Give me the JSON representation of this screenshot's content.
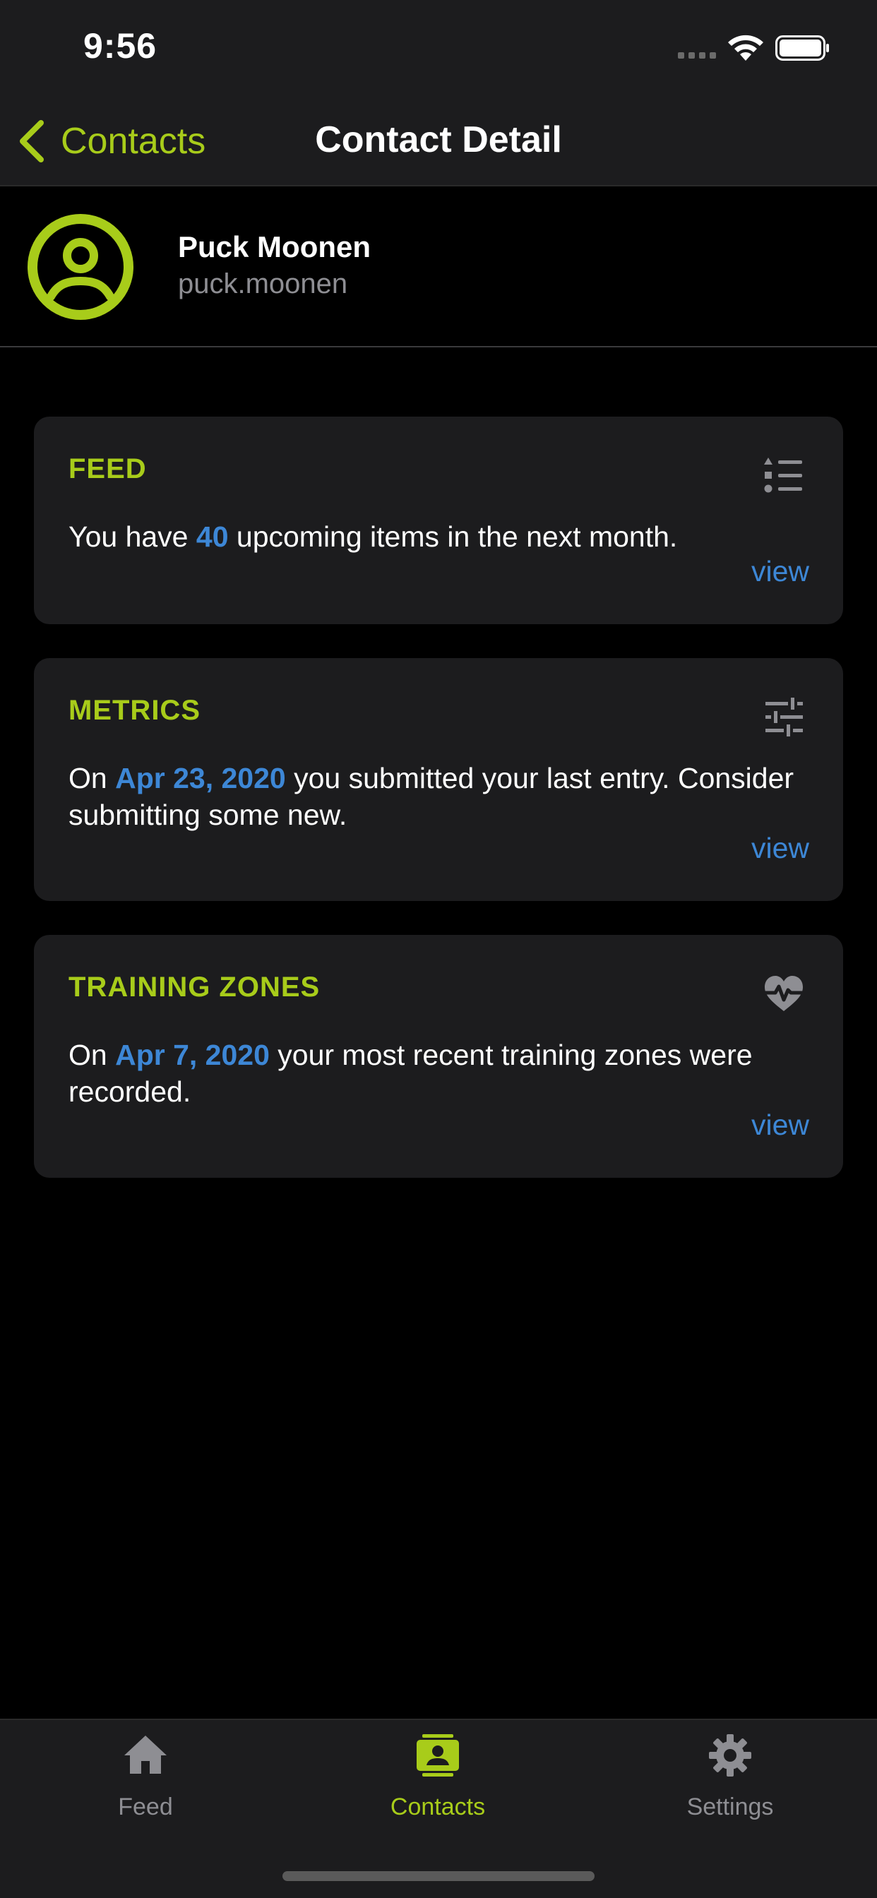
{
  "status_bar": {
    "time": "9:56"
  },
  "nav": {
    "back_label": "Contacts",
    "title": "Contact Detail"
  },
  "profile": {
    "name": "Puck Moonen",
    "username": "puck.moonen"
  },
  "cards": [
    {
      "title": "FEED",
      "icon": "list-icon",
      "text_before": "You have ",
      "highlight": "40",
      "text_after": " upcoming items in the next month.",
      "link": "view"
    },
    {
      "title": "METRICS",
      "icon": "sliders-icon",
      "text_before": "On ",
      "highlight": "Apr 23, 2020",
      "text_after": " you submitted your last entry. Consider submitting some new.",
      "link": "view"
    },
    {
      "title": "TRAINING ZONES",
      "icon": "heartbeat-icon",
      "text_before": "On ",
      "highlight": "Apr 7, 2020",
      "text_after": " your most recent training zones were recorded.",
      "link": "view"
    }
  ],
  "tabs": [
    {
      "label": "Feed",
      "icon": "home-icon",
      "active": false
    },
    {
      "label": "Contacts",
      "icon": "contact-card-icon",
      "active": true
    },
    {
      "label": "Settings",
      "icon": "gear-icon",
      "active": false
    }
  ],
  "colors": {
    "accent": "#a8cc1a",
    "link": "#3d87d6",
    "background": "#000000",
    "surface": "#1c1c1e",
    "muted": "#8e8e93"
  }
}
